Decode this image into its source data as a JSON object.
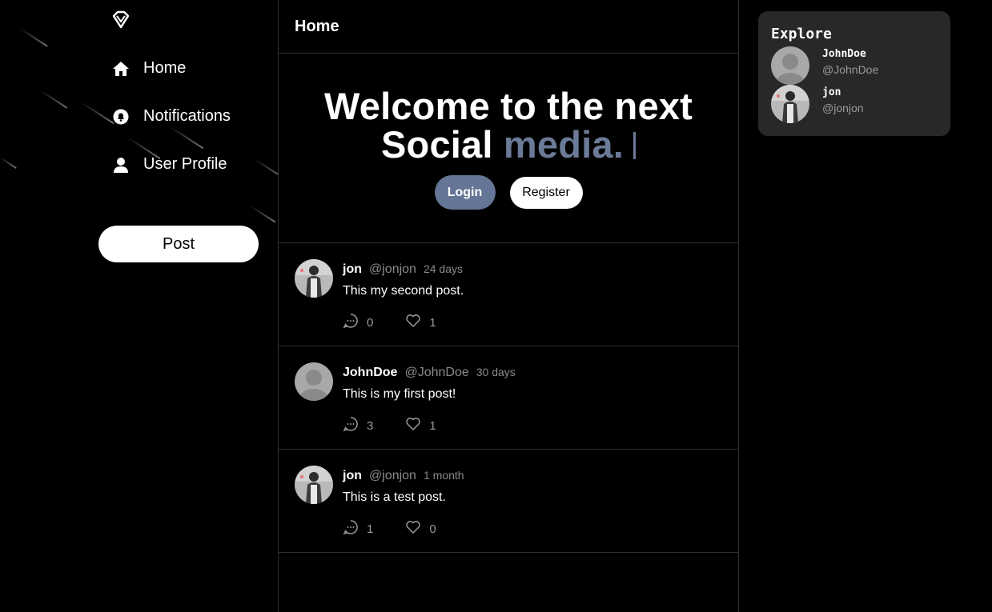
{
  "sidebar": {
    "logo": "diamond-logo",
    "items": [
      {
        "label": "Home",
        "icon": "home-icon"
      },
      {
        "label": "Notifications",
        "icon": "bell-icon"
      },
      {
        "label": "User Profile",
        "icon": "user-icon"
      }
    ],
    "post_label": "Post"
  },
  "main": {
    "header_title": "Home",
    "hero": {
      "line1": "Welcome to the next",
      "line2_plain": "Social",
      "line2_accent": "media.",
      "accent_color": "#6b7a96"
    },
    "login_label": "Login",
    "register_label": "Register"
  },
  "posts": [
    {
      "name": "jon",
      "handle": "@jonjon",
      "time": "24 days",
      "text": "This my second post.",
      "comments": "0",
      "likes": "1",
      "avatar": "photo"
    },
    {
      "name": "JohnDoe",
      "handle": "@JohnDoe",
      "time": "30 days",
      "text": "This is my first post!",
      "comments": "3",
      "likes": "1",
      "avatar": "default"
    },
    {
      "name": "jon",
      "handle": "@jonjon",
      "time": "1 month",
      "text": "This is a test post.",
      "comments": "1",
      "likes": "0",
      "avatar": "photo"
    }
  ],
  "explore": {
    "title": "Explore",
    "users": [
      {
        "name": "JohnDoe",
        "handle": "@JohnDoe",
        "avatar": "default"
      },
      {
        "name": "jon",
        "handle": "@jonjon",
        "avatar": "photo"
      }
    ]
  }
}
